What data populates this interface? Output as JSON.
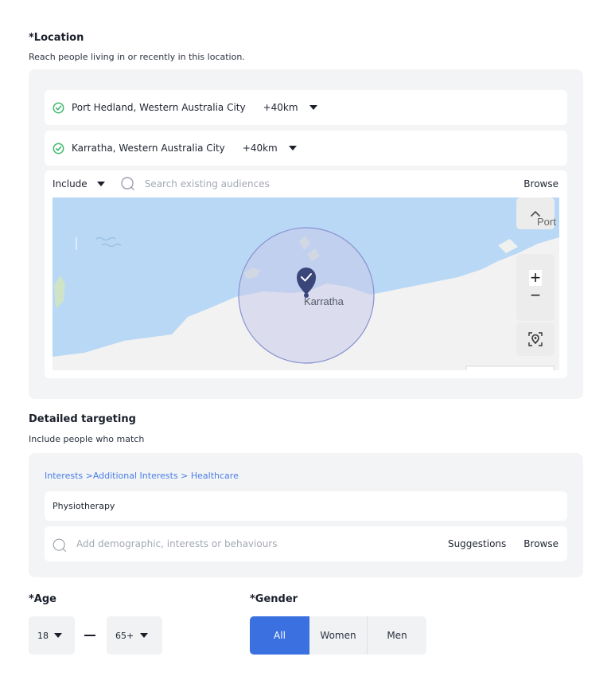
{
  "location": {
    "title": "*Location",
    "subtitle": "Reach people living in or recently in this location.",
    "items": [
      {
        "name": "Port Hedland, Western Australia City",
        "radius": "+40km"
      },
      {
        "name": "Karratha, Western Australia City",
        "radius": "+40km"
      }
    ],
    "toolbar": {
      "include_label": "Include",
      "search_placeholder": "Search existing audiences",
      "browse_label": "Browse"
    },
    "map": {
      "pin_label": "Karratha",
      "edge_label": "Port",
      "zoom_in": "+",
      "zoom_out": "−"
    },
    "colors": {
      "check": "#3db86b",
      "water": "#b9d8f5",
      "land": "#f2f2f2",
      "radius": "#8893d0",
      "pin": "#3a4679"
    }
  },
  "targeting": {
    "title": "Detailed targeting",
    "subtitle": "Include people who match",
    "breadcrumb": "Interests >Additional Interests > Healthcare",
    "selected_interest": "Physiotherapy",
    "search_placeholder": "Add demographic, interests or behaviours",
    "suggestions_label": "Suggestions",
    "browse_label": "Browse"
  },
  "age": {
    "title": "*Age",
    "min": "18",
    "max": "65+"
  },
  "gender": {
    "title": "*Gender",
    "options": [
      "All",
      "Women",
      "Men"
    ],
    "selected": "All",
    "accent": "#3a70e0"
  }
}
